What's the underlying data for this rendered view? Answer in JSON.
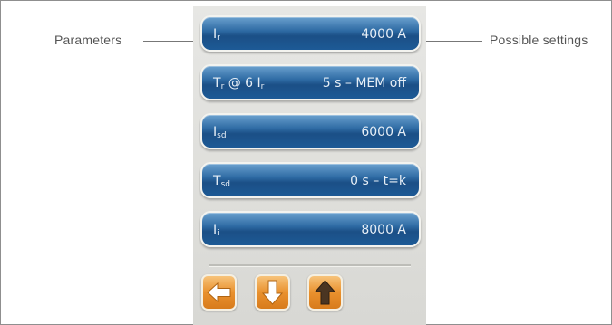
{
  "callouts": {
    "left": "Parameters",
    "right": "Possible settings"
  },
  "parameters": [
    {
      "symbol": "I",
      "subscript": "r",
      "suffix": "",
      "suffix_sub": "",
      "value": "4000 A"
    },
    {
      "symbol": "T",
      "subscript": "r",
      "suffix": " @ 6 I",
      "suffix_sub": "r",
      "value": "5 s – MEM off"
    },
    {
      "symbol": "I",
      "subscript": "sd",
      "suffix": "",
      "suffix_sub": "",
      "value": "6000 A"
    },
    {
      "symbol": "T",
      "subscript": "sd",
      "suffix": "",
      "suffix_sub": "",
      "value": "0 s – t=k"
    },
    {
      "symbol": "I",
      "subscript": "i",
      "suffix": "",
      "suffix_sub": "",
      "value": "8000 A"
    }
  ],
  "nav": {
    "back_icon": "arrow-left-icon",
    "down_icon": "arrow-down-icon",
    "up_icon": "arrow-up-icon"
  },
  "colors": {
    "button_blue": "#2d6aa3",
    "nav_orange": "#e9912e",
    "screen_bg": "#dcdcd8"
  }
}
